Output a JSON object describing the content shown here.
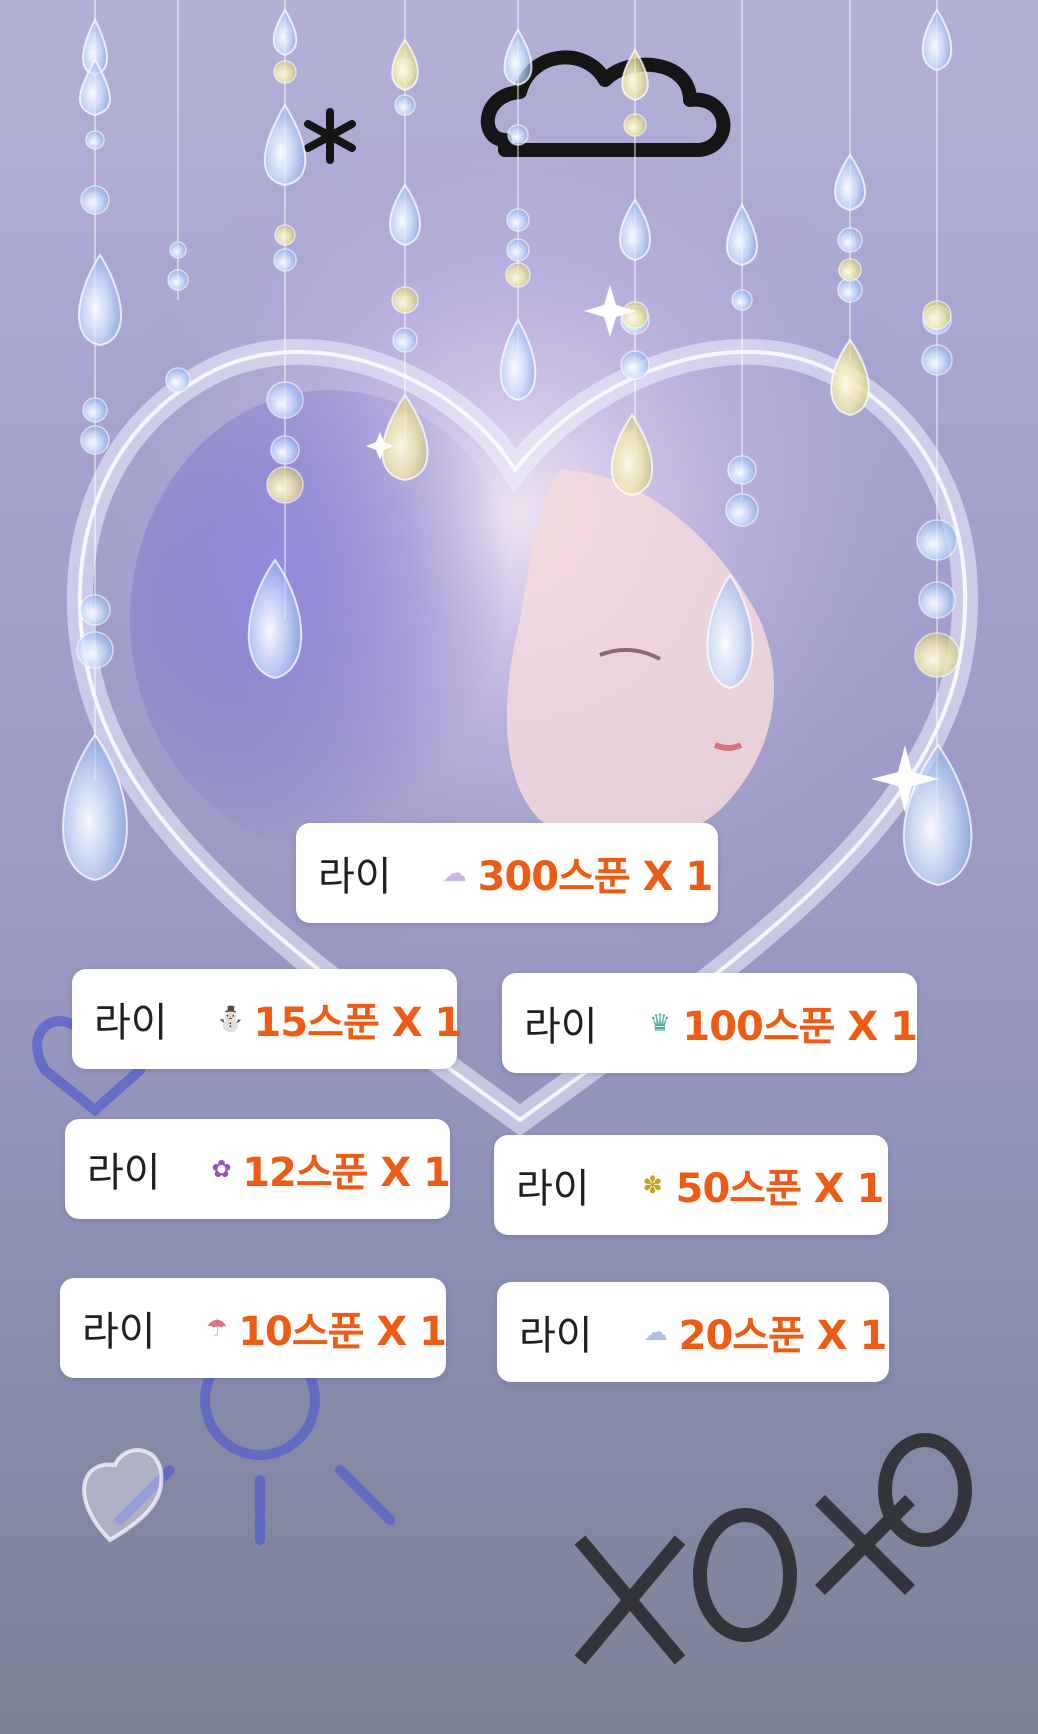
{
  "donations": [
    {
      "name": "라이",
      "gift_icon": "cloud-icon",
      "gift_glyph": "☁",
      "amount": "300스푼 X 1"
    },
    {
      "name": "라이",
      "gift_icon": "bear-icon",
      "gift_glyph": "⛄",
      "amount": "15스푼 X 1"
    },
    {
      "name": "라이",
      "gift_icon": "crown-icon",
      "gift_glyph": "♛",
      "amount": "100스푼 X 1"
    },
    {
      "name": "라이",
      "gift_icon": "rose-icon",
      "gift_glyph": "✿",
      "amount": "12스푼 X 1"
    },
    {
      "name": "라이",
      "gift_icon": "pineapple-icon",
      "gift_glyph": "✽",
      "amount": "50스푼 X 1"
    },
    {
      "name": "라이",
      "gift_icon": "rainbow-icon",
      "gift_glyph": "☂",
      "amount": "10스푼 X 1"
    },
    {
      "name": "라이",
      "gift_icon": "rain-cloud-icon",
      "gift_glyph": "☁",
      "amount": "20스푼 X 1"
    }
  ],
  "colors": {
    "amount": "#ee5b14",
    "name": "#1f1f24",
    "card_bg": "#ffffff"
  }
}
